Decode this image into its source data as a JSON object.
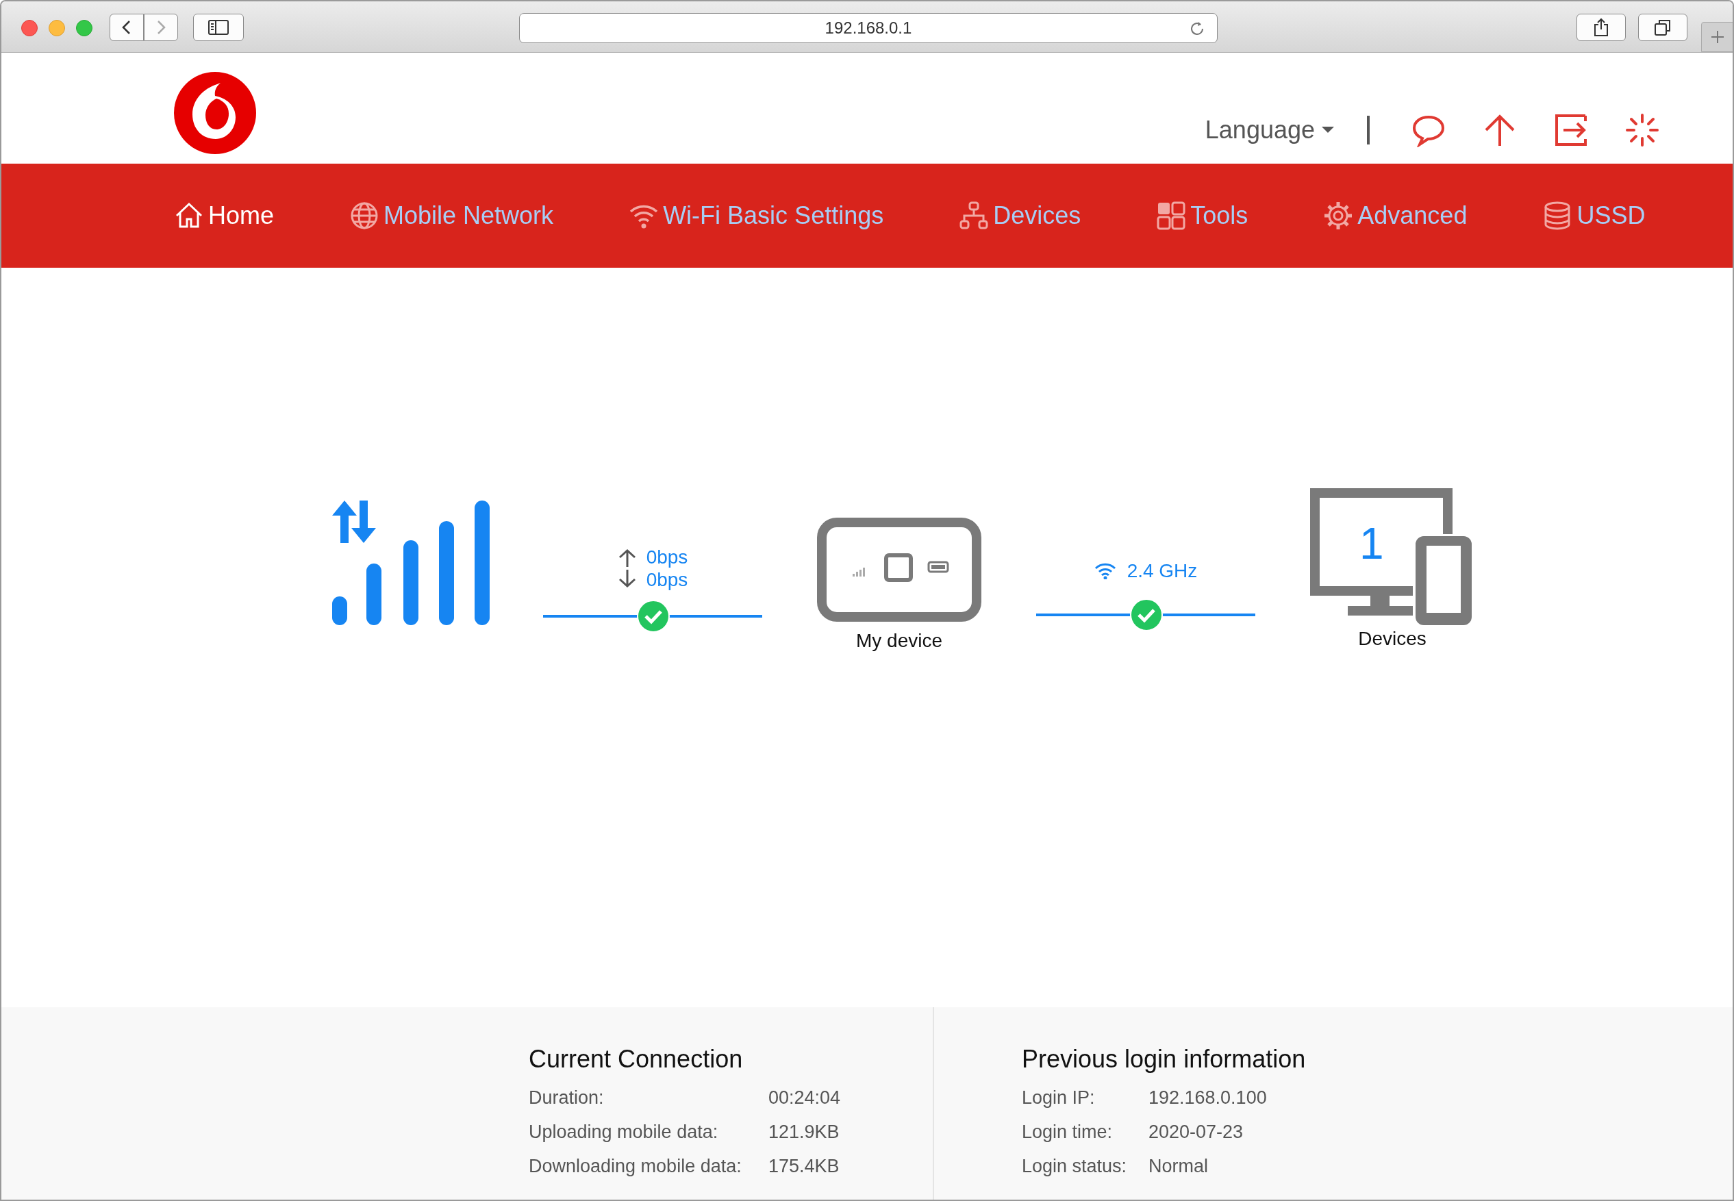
{
  "browser": {
    "address": "192.168.0.1"
  },
  "header": {
    "language": "Language"
  },
  "nav": [
    {
      "label": "Home",
      "selected": true
    },
    {
      "label": "Mobile Network",
      "selected": false
    },
    {
      "label": "Wi-Fi Basic Settings",
      "selected": false
    },
    {
      "label": "Devices",
      "selected": false
    },
    {
      "label": "Tools",
      "selected": false
    },
    {
      "label": "Advanced",
      "selected": false
    },
    {
      "label": "USSD",
      "selected": false
    }
  ],
  "status": {
    "upload": "0bps",
    "download": "0bps",
    "wan_connected": true,
    "device_label": "My device",
    "band": "2.4 GHz",
    "wifi_connected": true,
    "device_count": "1",
    "devices_label": "Devices"
  },
  "footer": [
    {
      "title": "Current Connection",
      "rows": [
        {
          "label": "Duration:",
          "value": "00:24:04"
        },
        {
          "label": "Uploading mobile data:",
          "value": "121.9KB"
        },
        {
          "label": "Downloading mobile data:",
          "value": "175.4KB"
        }
      ]
    },
    {
      "title": "Previous login information",
      "rows": [
        {
          "label": "Login IP:",
          "value": "192.168.0.100"
        },
        {
          "label": "Login time:",
          "value": "2020-07-23"
        },
        {
          "label": "Login status:",
          "value": "Normal"
        }
      ]
    }
  ]
}
